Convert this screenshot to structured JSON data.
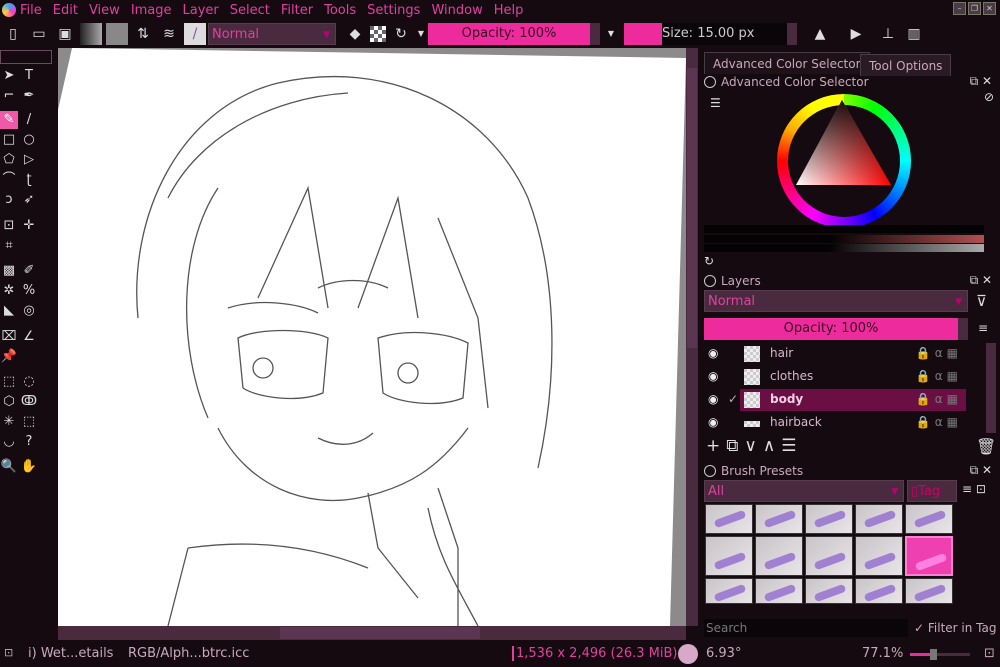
{
  "menu": [
    "File",
    "Edit",
    "View",
    "Image",
    "Layer",
    "Select",
    "Filter",
    "Tools",
    "Settings",
    "Window",
    "Help"
  ],
  "toolbar": {
    "blend_mode": "Normal",
    "opacity": "Opacity: 100%",
    "size": "Size: 15.00 px",
    "accent": "#ee2b9c"
  },
  "docks": {
    "tabs": [
      "Advanced Color Selector",
      "Tool Options"
    ],
    "color_selector_title": "Advanced Color Selector",
    "layers_title": "Layers",
    "layers_blend": "Normal",
    "layers_opacity": "Opacity:  100%",
    "layers": [
      {
        "name": "hair",
        "active": false
      },
      {
        "name": "clothes",
        "active": false
      },
      {
        "name": "body",
        "active": true
      },
      {
        "name": "hairback",
        "active": false
      }
    ],
    "brush_title": "Brush Presets",
    "brush_filter": "All",
    "tag_label": "Tag",
    "search_placeholder": "Search",
    "filter_in_tag": "Filter in Tag"
  },
  "status": {
    "tool": "i) Wet...etails",
    "profile": "RGB/Alph...btrc.icc",
    "dimensions": "1,536 x 2,496 (26.3 MiB)",
    "rotation": "6.93°",
    "zoom": "77.1%"
  }
}
